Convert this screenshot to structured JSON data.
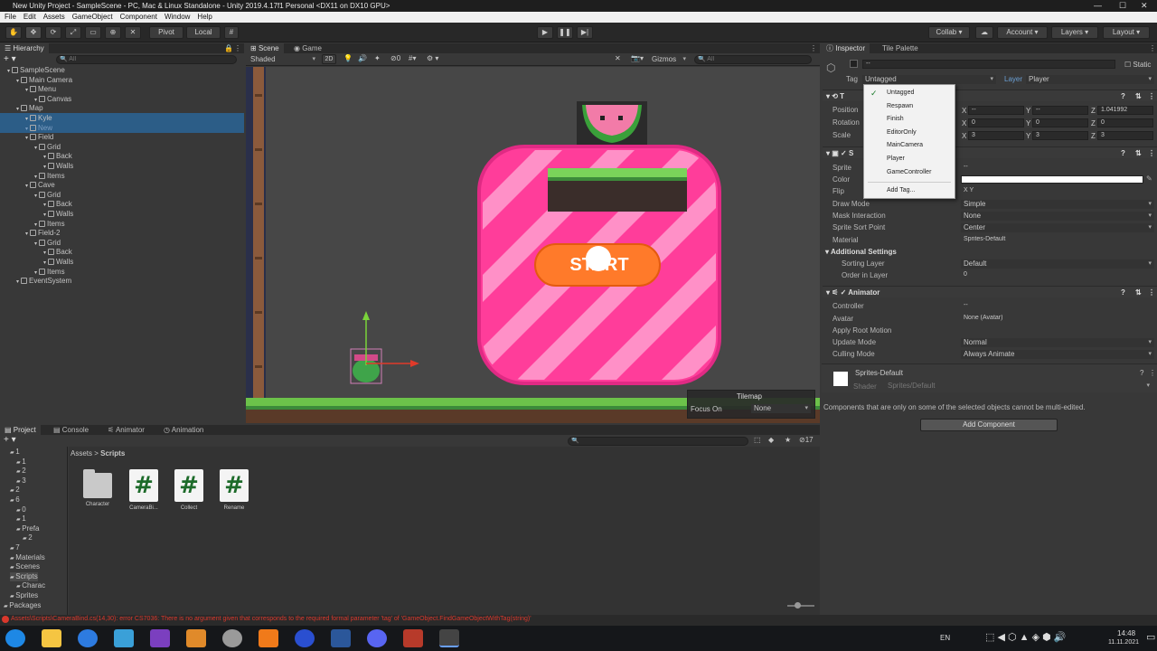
{
  "window": {
    "title": "New Unity Project - SampleScene - PC, Mac & Linux Standalone - Unity 2019.4.17f1 Personal <DX11 on DX10 GPU>"
  },
  "menu": [
    "File",
    "Edit",
    "Assets",
    "GameObject",
    "Component",
    "Window",
    "Help"
  ],
  "toolbar": {
    "pivot": "Pivot",
    "local": "Local",
    "collab": "Collab",
    "account": "Account",
    "layers": "Layers",
    "layout": "Layout"
  },
  "hierarchy": {
    "tab": "Hierarchy",
    "search_placeholder": "All",
    "items": [
      {
        "label": "SampleScene",
        "depth": 0
      },
      {
        "label": "Main Camera",
        "depth": 1
      },
      {
        "label": "Menu",
        "depth": 2
      },
      {
        "label": "Canvas",
        "depth": 3
      },
      {
        "label": "Map",
        "depth": 1
      },
      {
        "label": "Kyle",
        "depth": 2
      },
      {
        "label": "New",
        "depth": 2
      },
      {
        "label": "Field",
        "depth": 2
      },
      {
        "label": "Grid",
        "depth": 3
      },
      {
        "label": "Back",
        "depth": 4
      },
      {
        "label": "Walls",
        "depth": 4
      },
      {
        "label": "Items",
        "depth": 3
      },
      {
        "label": "Cave",
        "depth": 2
      },
      {
        "label": "Grid",
        "depth": 3
      },
      {
        "label": "Back",
        "depth": 4
      },
      {
        "label": "Walls",
        "depth": 4
      },
      {
        "label": "Items",
        "depth": 3
      },
      {
        "label": "Field-2",
        "depth": 2
      },
      {
        "label": "Grid",
        "depth": 3
      },
      {
        "label": "Back",
        "depth": 4
      },
      {
        "label": "Walls",
        "depth": 4
      },
      {
        "label": "Items",
        "depth": 3
      },
      {
        "label": "EventSystem",
        "depth": 1
      }
    ]
  },
  "scene": {
    "tabs": [
      "Scene",
      "Game"
    ],
    "shading": "Shaded",
    "mode2d": "2D",
    "gizmos": "Gizmos",
    "search": "All",
    "start_text": "START",
    "tilemap_overlay": {
      "title": "Tilemap",
      "focus_label": "Focus On",
      "focus_value": "None"
    }
  },
  "inspector": {
    "tabs": [
      "Inspector",
      "Tile Palette"
    ],
    "static": "Static",
    "tag_label": "Tag",
    "tag_value": "Untagged",
    "layer_label": "Layer",
    "layer_value": "Player",
    "tag_options": [
      "Untagged",
      "Respawn",
      "Finish",
      "EditorOnly",
      "MainCamera",
      "Player",
      "GameController"
    ],
    "add_tag": "Add Tag...",
    "transform": {
      "position_label": "Position",
      "rotation_label": "Rotation",
      "scale_label": "Scale",
      "position": {
        "x": "--",
        "y": "--",
        "z": "1.041992"
      },
      "rotation": {
        "x": "0",
        "y": "0",
        "z": "0"
      },
      "scale": {
        "x": "3",
        "y": "3",
        "z": "3"
      }
    },
    "sprite_renderer": {
      "title": "Sprite Renderer",
      "rows": [
        {
          "label": "Sprite",
          "value": "--"
        },
        {
          "label": "Color",
          "value": ""
        },
        {
          "label": "Flip",
          "value": "X    Y"
        },
        {
          "label": "Draw Mode",
          "value": "Simple"
        },
        {
          "label": "Mask Interaction",
          "value": "None"
        },
        {
          "label": "Sprite Sort Point",
          "value": "Center"
        },
        {
          "label": "Material",
          "value": "Sprites-Default"
        }
      ],
      "additional": "Additional Settings",
      "sorting_label": "Sorting Layer",
      "sorting_value": "Default",
      "order_label": "Order in Layer",
      "order_value": "0"
    },
    "animator": {
      "title": "Animator",
      "rows": [
        {
          "label": "Controller",
          "value": "--"
        },
        {
          "label": "Avatar",
          "value": "None (Avatar)"
        },
        {
          "label": "Apply Root Motion",
          "value": ""
        },
        {
          "label": "Update Mode",
          "value": "Normal"
        },
        {
          "label": "Culling Mode",
          "value": "Always Animate"
        }
      ]
    },
    "material": {
      "name": "Sprites-Default",
      "shader_label": "Shader",
      "shader_value": "Sprites/Default"
    },
    "warning": "Components that are only on some of the selected objects cannot be multi-edited.",
    "add_component": "Add Component"
  },
  "project": {
    "tabs": [
      "Project",
      "Console",
      "Animator",
      "Animation"
    ],
    "breadcrumb": [
      "Assets",
      "Scripts"
    ],
    "count": "17",
    "tree": [
      {
        "label": "1",
        "depth": 1
      },
      {
        "label": "1",
        "depth": 2
      },
      {
        "label": "2",
        "depth": 2
      },
      {
        "label": "3",
        "depth": 2
      },
      {
        "label": "2",
        "depth": 1
      },
      {
        "label": "6",
        "depth": 1
      },
      {
        "label": "0",
        "depth": 2
      },
      {
        "label": "1",
        "depth": 2
      },
      {
        "label": "Prefa",
        "depth": 2
      },
      {
        "label": "2",
        "depth": 3
      },
      {
        "label": "7",
        "depth": 1
      },
      {
        "label": "Materials",
        "depth": 1
      },
      {
        "label": "Scenes",
        "depth": 1
      },
      {
        "label": "Scripts",
        "depth": 1
      },
      {
        "label": "Charac",
        "depth": 2
      },
      {
        "label": "Sprites",
        "depth": 1
      },
      {
        "label": "Packages",
        "depth": 0
      }
    ],
    "assets": [
      {
        "name": "Character",
        "kind": "folder"
      },
      {
        "name": "CameraBi...",
        "kind": "script"
      },
      {
        "name": "Collect",
        "kind": "script"
      },
      {
        "name": "Rename",
        "kind": "script"
      }
    ]
  },
  "status": {
    "error": "Assets\\Scripts\\CameraBind.cs(14,30): error CS7036: There is no argument given that corresponds to the required formal parameter 'tag' of 'GameObject.FindGameObjectWithTag(string)'"
  },
  "taskbar": {
    "lang": "EN",
    "time": "14:48",
    "date": "11.11.2021"
  },
  "colors": {
    "accent": "#2c5d87",
    "pink": "#ff3d9a",
    "grass": "#6cc24a",
    "error": "#d9382c"
  }
}
